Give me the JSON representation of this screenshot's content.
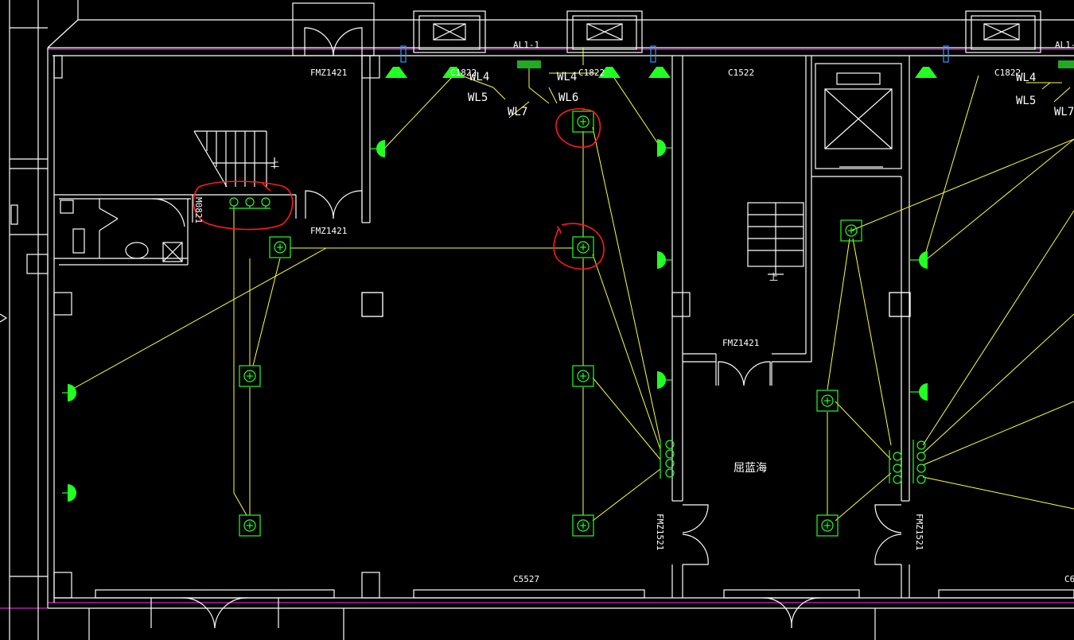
{
  "labels": {
    "fmz_1": "FMZ1421",
    "fmz_2": "FMZ1421",
    "fmz_3": "FMZ1421",
    "fmz_v1": "FMZ1521",
    "fmz_v2": "FMZ1521",
    "m0821": "M0821",
    "c1822_a": "C1822",
    "c1822_b": "C1822",
    "c1822_c": "C1822",
    "c1522": "C1522",
    "c5527": "C5527",
    "c6_partial": "C6",
    "al1_a": "AL1-1",
    "al1_b": "AL1-1",
    "wl4_a": "WL4",
    "wl4_b": "WL4",
    "wl4_c": "WL4",
    "wl5_a": "WL5",
    "wl5_b": "WL5",
    "wl6": "WL6",
    "wl7": "WL7",
    "wl_partial": "WL7",
    "room_name": "屈蓝海",
    "stair_1": "上",
    "stair_2": "上"
  },
  "colors": {
    "background": "#000000",
    "walls": "#ffffff",
    "wiring": "#ffff40",
    "fixtures": "#22ff22",
    "markup": "#ff1a1a",
    "axis": "#ff33ff"
  },
  "fixtures": {
    "ceiling_light_icon": "grid-lamp-icon",
    "wall_light_icon": "wall-lamp-icon",
    "switch_icon": "switch-group-icon"
  }
}
